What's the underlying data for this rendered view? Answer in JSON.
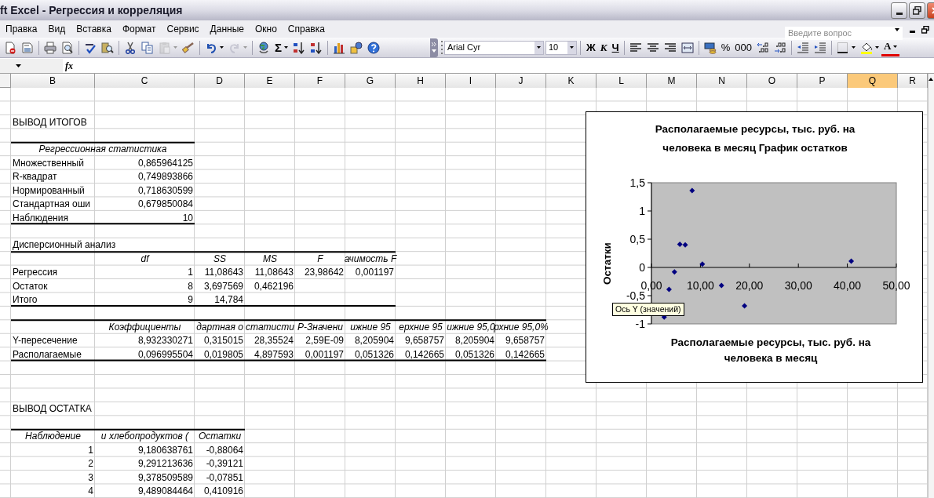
{
  "window": {
    "title": "ft Excel - Регрессия и корреляция"
  },
  "menu": [
    "Правка",
    "Вид",
    "Вставка",
    "Формат",
    "Сервис",
    "Данные",
    "Окно",
    "Справка"
  ],
  "help_box": {
    "placeholder": "Введите вопрос"
  },
  "standard_toolbar": [
    {
      "kind": "new",
      "disabled": false
    },
    {
      "kind": "permission",
      "disabled": false
    },
    {
      "kind": "print",
      "disabled": false
    },
    {
      "kind": "preview",
      "disabled": false
    },
    {
      "kind": "spelling",
      "disabled": false
    },
    {
      "kind": "research",
      "disabled": false
    },
    {
      "kind": "cut",
      "disabled": false
    },
    {
      "kind": "copy",
      "disabled": false
    },
    {
      "kind": "paste",
      "disabled": true
    },
    {
      "kind": "painter",
      "disabled": false
    },
    {
      "kind": "undo",
      "disabled": false
    },
    {
      "kind": "redo",
      "disabled": true
    },
    {
      "kind": "hyperlink",
      "disabled": false
    },
    {
      "kind": "autosum",
      "label": "Σ",
      "disabled": false
    },
    {
      "kind": "sort_asc",
      "disabled": false
    },
    {
      "kind": "sort_desc",
      "disabled": false
    },
    {
      "kind": "chart",
      "disabled": false
    },
    {
      "kind": "drawing",
      "disabled": false
    },
    {
      "kind": "help",
      "disabled": false
    }
  ],
  "formatting_toolbar": {
    "font": "Arial Cyr",
    "size": "10",
    "buttons": [
      {
        "kind": "bold",
        "label": "Ж"
      },
      {
        "kind": "italic",
        "label": "К"
      },
      {
        "kind": "underline",
        "label": "Ч"
      },
      {
        "kind": "align_left"
      },
      {
        "kind": "align_center"
      },
      {
        "kind": "align_right"
      },
      {
        "kind": "merge"
      },
      {
        "kind": "currency"
      },
      {
        "kind": "percent",
        "label": "%"
      },
      {
        "kind": "thousands",
        "label": "000"
      },
      {
        "kind": "inc_decimal"
      },
      {
        "kind": "dec_decimal"
      },
      {
        "kind": "outdent"
      },
      {
        "kind": "indent"
      },
      {
        "kind": "borders"
      },
      {
        "kind": "fill_color"
      },
      {
        "kind": "font_color",
        "label": "A"
      }
    ]
  },
  "formula_bar": {
    "fx": "fx"
  },
  "columns": [
    {
      "label": "B",
      "selected": false
    },
    {
      "label": "C",
      "selected": false
    },
    {
      "label": "D",
      "selected": false
    },
    {
      "label": "E",
      "selected": false
    },
    {
      "label": "F",
      "selected": false
    },
    {
      "label": "G",
      "selected": false
    },
    {
      "label": "H",
      "selected": false
    },
    {
      "label": "I",
      "selected": false
    },
    {
      "label": "J",
      "selected": false
    },
    {
      "label": "K",
      "selected": false
    },
    {
      "label": "L",
      "selected": false
    },
    {
      "label": "M",
      "selected": false
    },
    {
      "label": "N",
      "selected": false
    },
    {
      "label": "O",
      "selected": false
    },
    {
      "label": "P",
      "selected": false
    },
    {
      "label": "Q",
      "selected": true
    },
    {
      "label": "R",
      "selected": false
    }
  ],
  "summary": {
    "title": "ВЫВОД ИТОГОВ",
    "regression_statistics": {
      "header": "Регрессионная статистика",
      "rows": [
        {
          "label": "Множественный",
          "value": "0,865964125"
        },
        {
          "label": "R-квадрат",
          "value": "0,749893866"
        },
        {
          "label": "Нормированный",
          "value": "0,718630599"
        },
        {
          "label": "Стандартная оши",
          "value": "0,679850084"
        },
        {
          "label": "Наблюдения",
          "value": "10"
        }
      ]
    },
    "anova": {
      "title": "Дисперсионный анализ",
      "columns": [
        "df",
        "SS",
        "MS",
        "F",
        "ачимость F"
      ],
      "rows": [
        {
          "label": "Регрессия",
          "values": [
            "1",
            "11,08643",
            "11,08643",
            "23,98642",
            "0,001197"
          ]
        },
        {
          "label": "Остаток",
          "values": [
            "8",
            "3,697569",
            "0,462196"
          ]
        },
        {
          "label": "Итого",
          "values": [
            "9",
            "14,784"
          ]
        }
      ]
    },
    "coefficients": {
      "columns": [
        "Коэффициенты",
        "дартная о",
        "статисти",
        "P-Значени",
        "ижние 95",
        "ерхние 95",
        "ижние 95,0",
        "рхние 95,0%"
      ],
      "rows": [
        {
          "label": "Y-пересечение",
          "values": [
            "8,932330271",
            "0,315015",
            "28,35524",
            "2,59E-09",
            "8,205904",
            "9,658757",
            "8,205904",
            "9,658757"
          ]
        },
        {
          "label": "Располагаемые",
          "values": [
            "0,096995504",
            "0,019805",
            "4,897593",
            "0,001197",
            "0,051326",
            "0,142665",
            "0,051326",
            "0,142665"
          ]
        }
      ]
    }
  },
  "residual_output": {
    "title": "ВЫВОД ОСТАТКА",
    "columns": [
      "Наблюдение",
      "и хлебопродуктов (",
      "Остатки"
    ],
    "rows": [
      [
        "1",
        "9,180638761",
        "-0,88064"
      ],
      [
        "2",
        "9,291213636",
        "-0,39121"
      ],
      [
        "3",
        "9,378509589",
        "-0,07851"
      ],
      [
        "4",
        "9,489084464",
        "0,410916"
      ]
    ]
  },
  "chart": {
    "chart_data": {
      "type": "scatter",
      "title": "Располагаемые ресурсы, тыс. руб. на человека в месяц График остатков",
      "xlabel": "Располагаемые ресурсы, тыс. руб. на человека в месяц",
      "ylabel": "Остатки",
      "x": [
        2.6,
        3.6,
        4.7,
        5.8,
        6.9,
        8.3,
        10.4,
        14.3,
        19.0,
        40.8
      ],
      "series": [
        {
          "color": "#000080",
          "values": [
            -0.88,
            -0.39,
            -0.08,
            0.41,
            0.4,
            1.36,
            0.06,
            -0.32,
            -0.68,
            0.11
          ]
        }
      ],
      "xlim": [
        0,
        50
      ],
      "ylim": [
        -1,
        1.5
      ],
      "xticks": [
        {
          "value": 0,
          "label": "0,00"
        },
        {
          "value": 10,
          "label": "10,00"
        },
        {
          "value": 20,
          "label": "20,00"
        },
        {
          "value": 30,
          "label": "30,00"
        },
        {
          "value": 40,
          "label": "40,00"
        },
        {
          "value": 50,
          "label": "50,00"
        }
      ],
      "yticks": [
        {
          "value": -1,
          "label": "-1"
        },
        {
          "value": -0.5,
          "label": "-0,5"
        },
        {
          "value": 0,
          "label": "0"
        },
        {
          "value": 0.5,
          "label": "0,5"
        },
        {
          "value": 1,
          "label": "1"
        },
        {
          "value": 1.5,
          "label": "1,5"
        }
      ]
    },
    "tooltip": "Ось Y (значений)"
  }
}
